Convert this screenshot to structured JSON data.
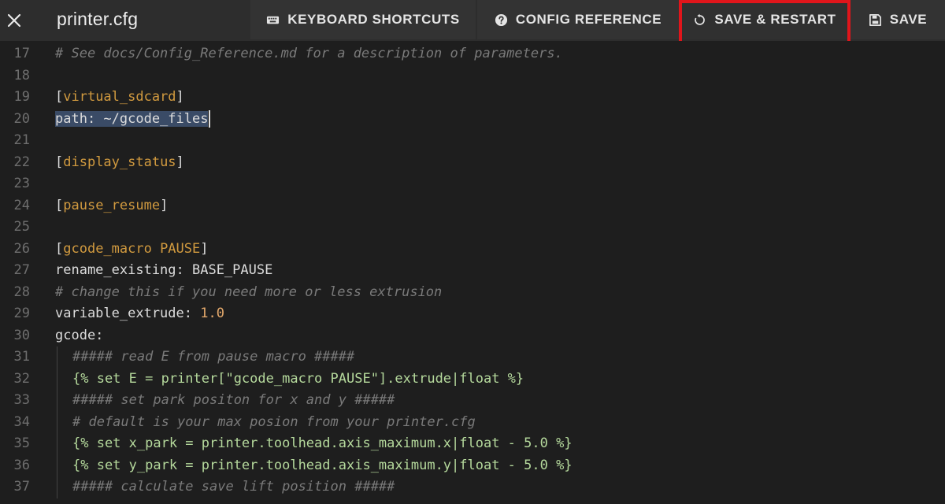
{
  "toolbar": {
    "file_name": "printer.cfg",
    "buttons": {
      "keyboard_shortcuts": "KEYBOARD SHORTCUTS",
      "config_reference": "CONFIG REFERENCE",
      "save_restart": "SAVE & RESTART",
      "save": "SAVE"
    },
    "icons": {
      "close": "close-icon",
      "keyboard": "keyboard-icon",
      "help": "help-circle-icon",
      "restart": "restart-icon",
      "save": "floppy-disk-icon"
    }
  },
  "highlight_color": "#e0151b",
  "editor": {
    "lines": [
      {
        "n": "17",
        "t": "# See docs/Config_Reference.md for a description of parameters."
      },
      {
        "n": "18",
        "t": ""
      },
      {
        "n": "19",
        "t": "[virtual_sdcard]"
      },
      {
        "n": "20",
        "t": "path: ~/gcode_files"
      },
      {
        "n": "21",
        "t": ""
      },
      {
        "n": "22",
        "t": "[display_status]"
      },
      {
        "n": "23",
        "t": ""
      },
      {
        "n": "24",
        "t": "[pause_resume]"
      },
      {
        "n": "25",
        "t": ""
      },
      {
        "n": "26",
        "t": "[gcode_macro PAUSE]"
      },
      {
        "n": "27",
        "t": "rename_existing: BASE_PAUSE"
      },
      {
        "n": "28",
        "t": "# change this if you need more or less extrusion"
      },
      {
        "n": "29",
        "t": "variable_extrude: 1.0"
      },
      {
        "n": "30",
        "t": "gcode:"
      },
      {
        "n": "31",
        "t": "##### read E from pause macro #####"
      },
      {
        "n": "32",
        "t": "{% set E = printer[\"gcode_macro PAUSE\"].extrude|float %}"
      },
      {
        "n": "33",
        "t": "##### set park positon for x and y #####"
      },
      {
        "n": "34",
        "t": "# default is your max posion from your printer.cfg"
      },
      {
        "n": "35",
        "t": "{% set x_park = printer.toolhead.axis_maximum.x|float - 5.0 %}"
      },
      {
        "n": "36",
        "t": "{% set y_park = printer.toolhead.axis_maximum.y|float - 5.0 %}"
      },
      {
        "n": "37",
        "t": "##### calculate save lift position #####"
      }
    ]
  }
}
